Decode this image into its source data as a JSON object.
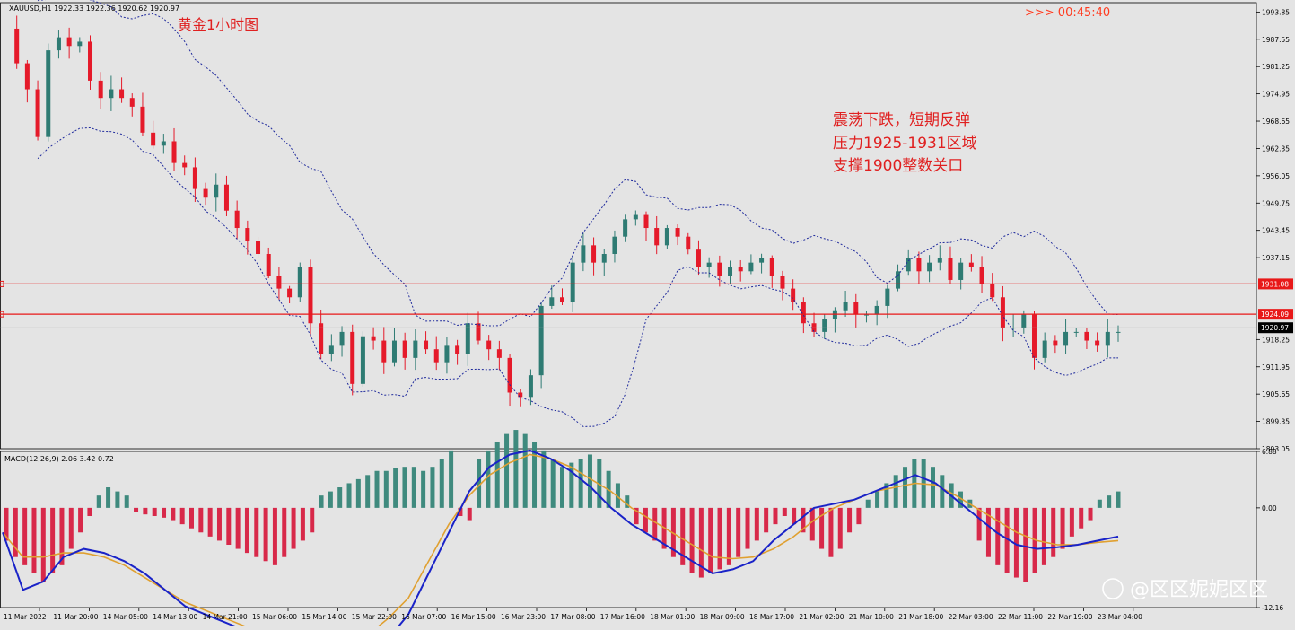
{
  "header": {
    "symbol_info": "XAUUSD,H1  1922.33 1922.36 1920.62 1920.97",
    "chart_title": "黄金1小时图",
    "countdown": ">>>  00:45:40"
  },
  "annotations": [
    "震荡下跌，短期反弹",
    "压力1925-1931区域",
    "支撑1900整数关口"
  ],
  "watermark": "@区区妮妮区区",
  "colors": {
    "bull": "#2e7b73",
    "bear": "#e51a2a",
    "band": "#1f2a9c",
    "macd_line": "#1a23c8",
    "signal_line": "#e0a030",
    "level": "#e81818",
    "hist_pos": "#3f8a7e",
    "hist_neg": "#d8294a"
  },
  "chart_data": [
    {
      "type": "candlestick",
      "instrument": "XAUUSD",
      "timeframe": "H1",
      "ylim": [
        1893.05,
        1996.0
      ],
      "y_ticks": [
        "1993.85",
        "1987.55",
        "1981.25",
        "1974.95",
        "1968.65",
        "1962.35",
        "1956.05",
        "1949.75",
        "1943.45",
        "1937.15",
        "1918.25",
        "1911.95",
        "1905.65",
        "1899.35",
        "1893.05"
      ],
      "x_ticks": [
        "11 Mar 2022",
        "11 Mar 20:00",
        "14 Mar 05:00",
        "14 Mar 13:00",
        "14 Mar 21:00",
        "15 Mar 06:00",
        "15 Mar 14:00",
        "15 Mar 22:00",
        "16 Mar 07:00",
        "16 Mar 15:00",
        "16 Mar 23:00",
        "17 Mar 08:00",
        "17 Mar 16:00",
        "18 Mar 01:00",
        "18 Mar 09:00",
        "18 Mar 17:00",
        "21 Mar 02:00",
        "21 Mar 10:00",
        "21 Mar 18:00",
        "22 Mar 03:00",
        "22 Mar 11:00",
        "22 Mar 19:00",
        "23 Mar 04:00"
      ],
      "close_path": [
        1990,
        1982,
        1976,
        1965,
        1985,
        1988,
        1986,
        1987,
        1978,
        1974,
        1976,
        1974,
        1972,
        1966,
        1963,
        1964,
        1959,
        1958,
        1953,
        1951,
        1954,
        1948,
        1944,
        1941,
        1938,
        1933,
        1930,
        1928,
        1935,
        1922,
        1915,
        1917,
        1920,
        1908,
        1919,
        1918,
        1913,
        1918,
        1914,
        1918,
        1916,
        1913,
        1917,
        1915,
        1922,
        1918,
        1916,
        1914,
        1906,
        1905,
        1910,
        1926,
        1928,
        1927,
        1936,
        1940,
        1936,
        1938,
        1942,
        1946,
        1947,
        1944,
        1940,
        1944,
        1942,
        1939,
        1935,
        1936,
        1933,
        1935,
        1934,
        1936,
        1937,
        1933,
        1930,
        1927,
        1922,
        1920,
        1923,
        1925,
        1927,
        1924,
        1924,
        1926,
        1930,
        1934,
        1937,
        1934,
        1936,
        1937,
        1932,
        1936,
        1935,
        1931,
        1928,
        1921,
        1921,
        1924,
        1914,
        1918,
        1917,
        1920,
        1920,
        1918,
        1917,
        1920,
        1920
      ],
      "levels": [
        {
          "value": 1931.08,
          "label": "1931.08"
        },
        {
          "value": 1924.09,
          "label": "1924.09"
        }
      ],
      "last_price": {
        "value": 1920.97,
        "label": "1920.97"
      },
      "indicators": [
        "Bollinger Bands"
      ]
    },
    {
      "type": "macd",
      "title": "MACD(12,26,9)  2.06  3.42  0.72",
      "ylim": [
        -12.16,
        6.88
      ],
      "y_ticks": [
        "6.88",
        "0.00",
        "-12.16"
      ],
      "histogram": [
        -4,
        -6,
        -7,
        -8,
        -9,
        -8,
        -7,
        -5,
        -3,
        -1,
        1.5,
        2.5,
        2,
        1.5,
        -0.5,
        -0.8,
        -1,
        -1.2,
        -1.5,
        -2,
        -2.5,
        -3,
        -3.5,
        -4,
        -4.5,
        -5,
        -5.5,
        -6,
        -6.5,
        -7,
        -6,
        -5,
        -4,
        -3,
        1.5,
        2,
        2.5,
        3,
        3.5,
        4,
        4.5,
        4.5,
        4.8,
        5,
        5,
        4.5,
        5,
        6,
        7,
        -1,
        -1.5,
        6,
        7,
        8,
        9,
        9.5,
        9,
        8,
        7,
        6,
        5,
        5.5,
        6,
        6.5,
        6,
        4.5,
        3,
        1.5,
        -2,
        -3,
        -4,
        -5,
        -6,
        -7,
        -8,
        -8.5,
        -8,
        -7.5,
        -7,
        -6,
        -5,
        -4,
        -3,
        -2,
        -1,
        -2,
        -3,
        -4,
        -5,
        -6,
        -5,
        -3,
        -2,
        1,
        2,
        3,
        4,
        5,
        6,
        6,
        5,
        4,
        3,
        2,
        1,
        -4,
        -6,
        -7,
        -8,
        -8.5,
        -9,
        -8,
        -7,
        -6,
        -5,
        -3.5,
        -2.5,
        -1.5,
        1,
        1.5,
        2
      ],
      "macd": [
        -3,
        -10,
        -9,
        -6,
        -5,
        -5.5,
        -6.5,
        -8,
        -10,
        -12,
        -13,
        -14,
        -15,
        -15.5,
        -16,
        -17,
        -18,
        -18.5,
        -18,
        -16,
        -13,
        -8,
        -3,
        2,
        5,
        6.5,
        7,
        6,
        4.5,
        2.5,
        0,
        -2,
        -3.5,
        -5,
        -6.5,
        -8,
        -7.5,
        -6.5,
        -4,
        -2,
        0,
        0.5,
        1,
        2,
        3,
        4,
        3,
        1,
        -1,
        -3,
        -4.5,
        -5,
        -4.8,
        -4.5,
        -4,
        -3.5
      ],
      "signal": [
        -3,
        -6,
        -6,
        -5.5,
        -5.5,
        -6,
        -7,
        -8.5,
        -10,
        -11.5,
        -12.5,
        -13.5,
        -14.5,
        -15.5,
        -16,
        -16.5,
        -16.8,
        -16.5,
        -15.5,
        -13.5,
        -11,
        -6.5,
        -2,
        1.5,
        4,
        5.5,
        6.5,
        6,
        5,
        3.5,
        2,
        0,
        -1.5,
        -3,
        -4.5,
        -6,
        -6.2,
        -6,
        -5,
        -3.5,
        -1.5,
        0,
        1,
        2,
        2.5,
        3,
        2.8,
        1.5,
        0,
        -1.5,
        -3,
        -4,
        -4.5,
        -4.5,
        -4.2,
        -4
      ]
    }
  ]
}
